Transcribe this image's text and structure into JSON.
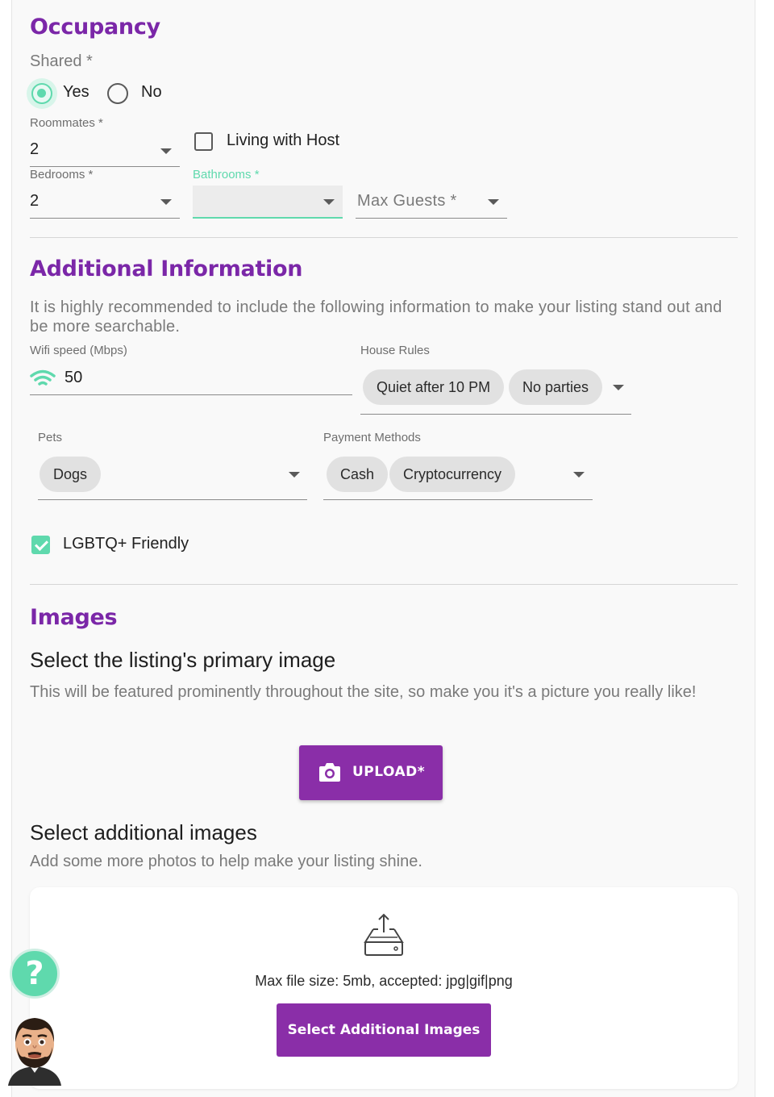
{
  "occupancy": {
    "title": "Occupancy",
    "shared_label": "Shared *",
    "shared_options": [
      {
        "label": "Yes",
        "selected": true
      },
      {
        "label": "No",
        "selected": false
      }
    ],
    "roommates": {
      "label": "Roommates *",
      "value": "2"
    },
    "living_with_host": {
      "label": "Living with Host",
      "checked": false
    },
    "bedrooms": {
      "label": "Bedrooms *",
      "value": "2"
    },
    "bathrooms": {
      "label": "Bathrooms *",
      "value": ""
    },
    "max_guests": {
      "placeholder": "Max Guests *"
    }
  },
  "additional": {
    "title": "Additional Information",
    "description": "It is highly recommended to include the following information to make your listing stand out and be more searchable.",
    "wifi": {
      "label": "Wifi speed (Mbps)",
      "value": "50",
      "icon": "wifi-icon"
    },
    "house_rules": {
      "label": "House Rules",
      "chips": [
        "Quiet after 10 PM",
        "No parties"
      ]
    },
    "pets": {
      "label": "Pets",
      "chips": [
        "Dogs"
      ]
    },
    "payment": {
      "label": "Payment Methods",
      "chips": [
        "Cash",
        "Cryptocurrency"
      ]
    },
    "lgbtq": {
      "label": "LGBTQ+ Friendly",
      "checked": true
    }
  },
  "images": {
    "title": "Images",
    "primary_heading": "Select the listing's primary image",
    "primary_description": "This will be featured prominently throughout the site, so make you it's a picture you really like!",
    "upload_label": "UPLOAD*",
    "additional_heading": "Select additional images",
    "additional_description": "Add some more photos to help make your listing shine.",
    "file_info": "Max file size: 5mb, accepted: jpg|gif|png",
    "select_additional_label": "Select Additional Images"
  },
  "help": {
    "icon_text": "?"
  },
  "colors": {
    "accent_purple": "#7b27a8",
    "button_purple": "#8a2ea8",
    "accent_teal": "#5fd9ad"
  }
}
